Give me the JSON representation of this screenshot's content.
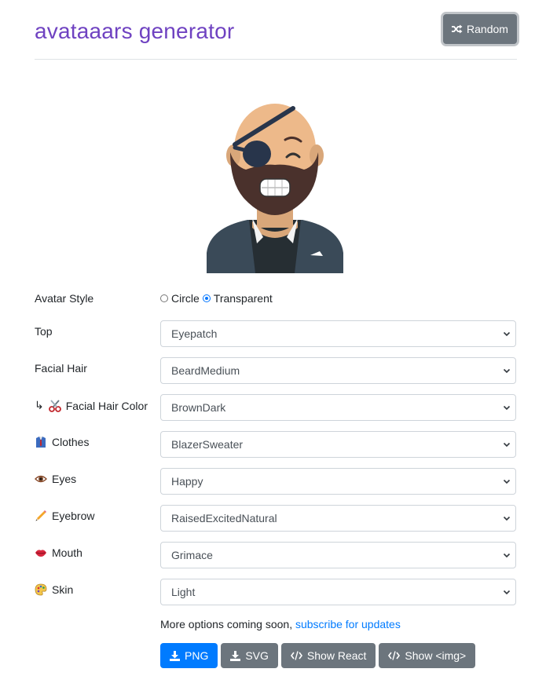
{
  "header": {
    "title": "avataaars generator",
    "random_label": "Random"
  },
  "form": {
    "avatar_style": {
      "label": "Avatar Style",
      "options": [
        "Circle",
        "Transparent"
      ],
      "selected": "Transparent"
    },
    "fields": [
      {
        "label": "Top",
        "value": "Eyepatch",
        "icon": ""
      },
      {
        "label": "Facial Hair",
        "value": "BeardMedium",
        "icon": ""
      },
      {
        "label": "Facial Hair Color",
        "value": "BrownDark",
        "icon": "scissors-icon",
        "prefix": "↳"
      },
      {
        "label": "Clothes",
        "value": "BlazerSweater",
        "icon": "shirt-icon"
      },
      {
        "label": "Eyes",
        "value": "Happy",
        "icon": "eye-icon"
      },
      {
        "label": "Eyebrow",
        "value": "RaisedExcitedNatural",
        "icon": "pencil-icon"
      },
      {
        "label": "Mouth",
        "value": "Grimace",
        "icon": "lips-icon"
      },
      {
        "label": "Skin",
        "value": "Light",
        "icon": "palette-icon"
      }
    ]
  },
  "footer": {
    "note_text": "More options coming soon, ",
    "note_link": "subscribe for updates",
    "buttons": {
      "png": "PNG",
      "svg": "SVG",
      "react": "Show React",
      "img": "Show <img>"
    }
  },
  "colors": {
    "title": "#6f42c1",
    "primary": "#007bff",
    "secondary": "#6c757d"
  }
}
